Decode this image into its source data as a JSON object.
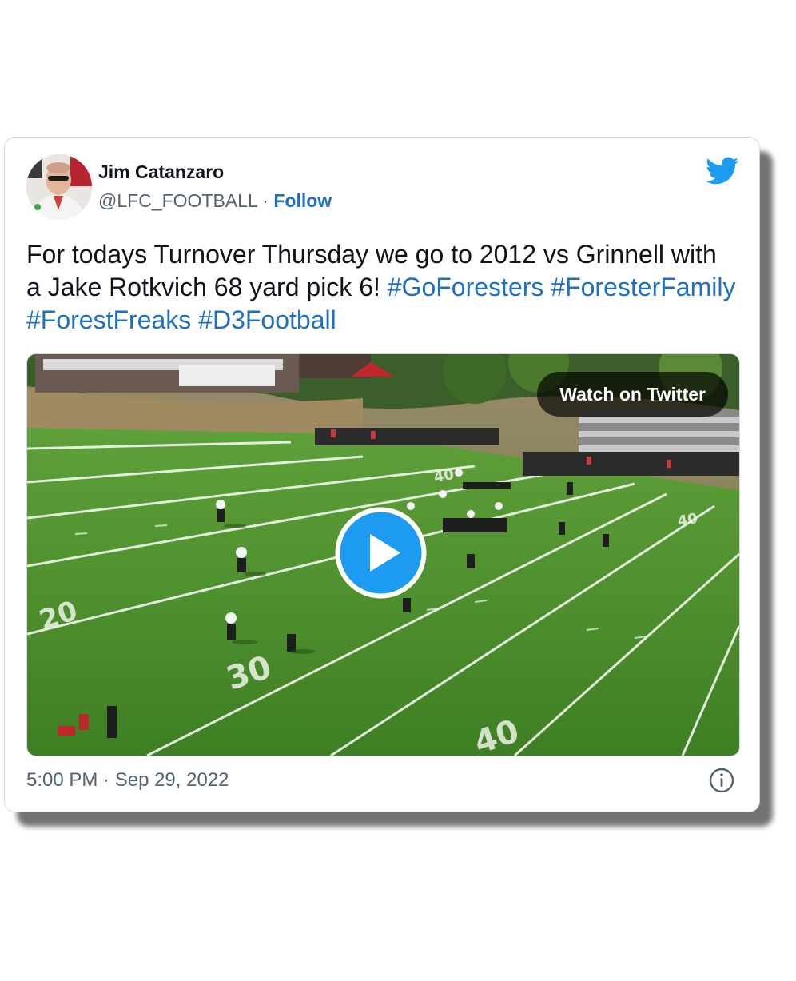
{
  "author": {
    "name": "Jim Catanzaro",
    "handle": "@LFC_FOOTBALL",
    "separator": "·",
    "follow_label": "Follow"
  },
  "tweet": {
    "text": "For todays Turnover Thursday we go to 2012 vs Grinnell with a Jake Rotkvich 68 yard pick 6!",
    "hashtags": [
      "#GoForesters",
      "#ForesterFamily",
      "#ForestFreaks",
      "#D3Football"
    ]
  },
  "media": {
    "watch_label": "Watch on Twitter",
    "yard_numbers": [
      "20",
      "30",
      "40",
      "40",
      "40"
    ],
    "icon": "play-icon"
  },
  "footer": {
    "timestamp": "5:00 PM · Sep 29, 2022",
    "info_icon": "info-icon"
  },
  "colors": {
    "link": "#1d70c2",
    "twitter_blue": "#1d9bf0",
    "text": "#0f1419",
    "muted": "#536471",
    "field_green": "#4e8f2c"
  }
}
